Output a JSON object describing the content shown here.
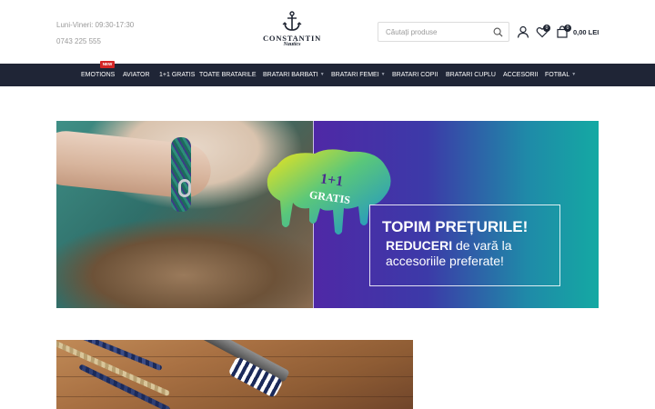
{
  "header": {
    "hours": "Luni-Vineri: 09:30-17:30",
    "phone": "0743 225 555",
    "logo_title": "CONSTANTIN",
    "logo_sub": "Nautics",
    "search_placeholder": "Căutați produse",
    "wishlist_count": "0",
    "cart_count": "0",
    "cart_total": "0,00 LEI"
  },
  "nav": {
    "new_badge": "NEW",
    "items": [
      {
        "label": "EMOTIONS",
        "has_caret": false
      },
      {
        "label": "AVIATOR",
        "has_caret": false
      },
      {
        "label": "1+1 GRATIS",
        "has_caret": false
      },
      {
        "label": "TOATE BRATARILE",
        "has_caret": false
      },
      {
        "label": "BRATARI BARBATI",
        "has_caret": true
      },
      {
        "label": "BRATARI FEMEI",
        "has_caret": true
      },
      {
        "label": "BRATARI COPII",
        "has_caret": false
      },
      {
        "label": "BRATARI CUPLU",
        "has_caret": false
      },
      {
        "label": "ACCESORII",
        "has_caret": false
      },
      {
        "label": "FOTBAL",
        "has_caret": true
      }
    ]
  },
  "hero": {
    "splash_line1": "1+1",
    "splash_line2": "GRATIS",
    "promo_title": "TOPIM PREȚURILE!",
    "promo_line1_bold": "REDUCERI",
    "promo_line1_rest": " de vară la",
    "promo_line2": "accesoriile preferate!"
  },
  "colors": {
    "nav_bg": "#1f2536",
    "badge_red": "#d32525",
    "brand_dark": "#1e2431"
  },
  "icons": [
    "search-icon",
    "user-icon",
    "heart-icon",
    "shopping-bag-icon",
    "anchor-icon",
    "chevron-down-icon"
  ]
}
